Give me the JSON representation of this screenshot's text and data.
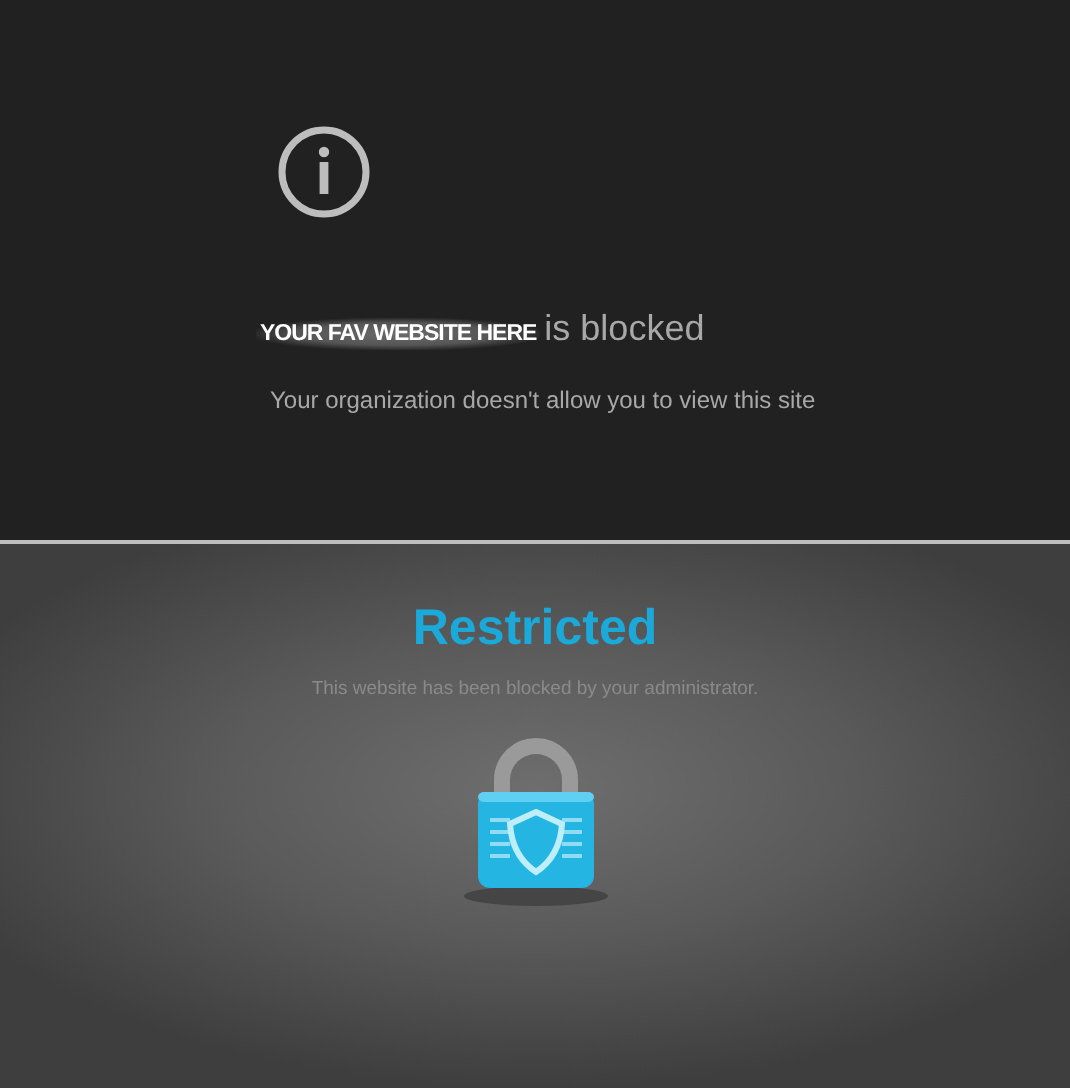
{
  "blocked_page": {
    "site_name": "YOUR FAV WEBSITE HERE",
    "heading_suffix": "is blocked",
    "message": "Your organization doesn't allow you to view this site"
  },
  "restricted_page": {
    "title": "Restricted",
    "message": "This website has been blocked by your administrator."
  }
}
